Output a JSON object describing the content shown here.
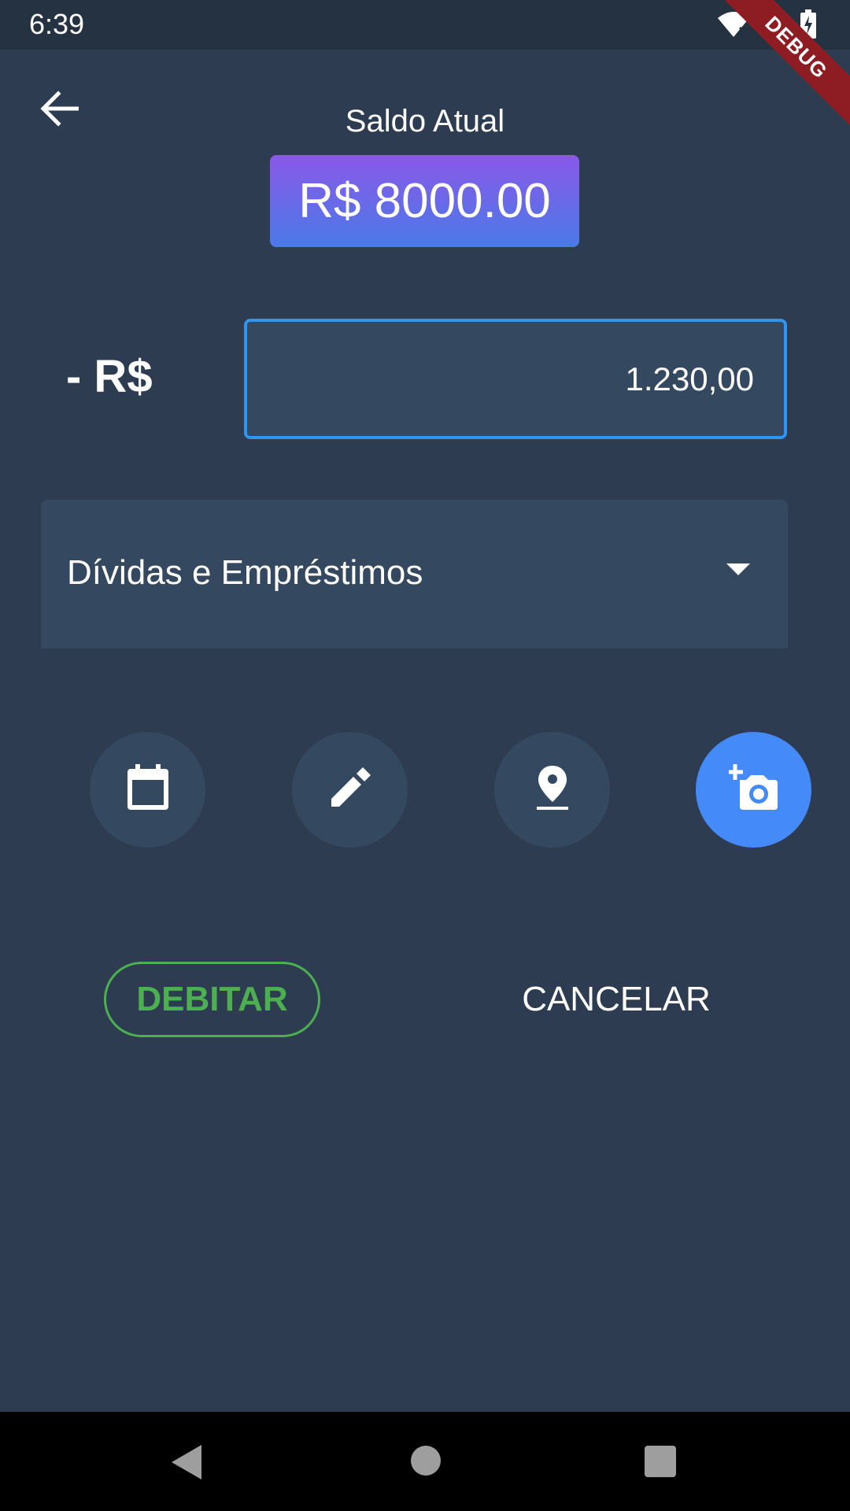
{
  "status_bar": {
    "time": "6:39",
    "icons": [
      "wifi-off-icon",
      "signal-icon",
      "battery-charging-icon"
    ]
  },
  "debug_banner": {
    "label": "DEBUG"
  },
  "header": {
    "back_icon": "arrow-back-icon",
    "balance_label": "Saldo Atual",
    "balance_value": "R$ 8000.00"
  },
  "amount": {
    "prefix": "- R$",
    "value": "1.230,00"
  },
  "category": {
    "selected": "Dívidas e Empréstimos",
    "caret_icon": "arrow-drop-down-icon"
  },
  "actions": [
    {
      "icon": "calendar-icon",
      "active": false
    },
    {
      "icon": "edit-icon",
      "active": false
    },
    {
      "icon": "location-pin-icon",
      "active": false
    },
    {
      "icon": "add-a-photo-icon",
      "active": true
    }
  ],
  "buttons": {
    "debit_label": "DEBITAR",
    "cancel_label": "CANCELAR"
  },
  "colors": {
    "background": "#2d3c50",
    "field": "#34495f",
    "accent_blue": "#448af8",
    "focus_border": "#2f95ee",
    "debit_green": "#4caf50",
    "gradient_top": "#8a58e8",
    "gradient_bottom": "#4a7ae8"
  },
  "nav_bar": {
    "icons": [
      "nav-back-icon",
      "nav-home-icon",
      "nav-recents-icon"
    ]
  }
}
